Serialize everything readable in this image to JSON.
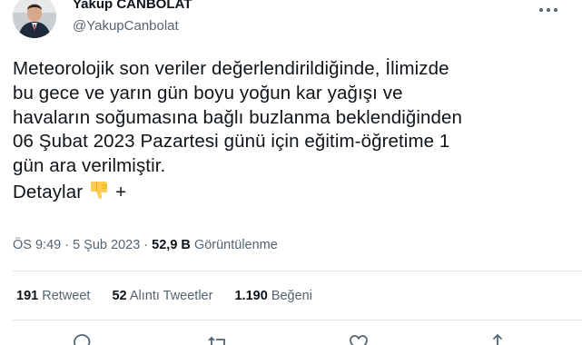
{
  "author": {
    "name": "Yakup CANBOLAT",
    "handle": "@YakupCanbolat"
  },
  "tweet": {
    "lines": [
      "Meteorolojik son veriler değerlendirildiğinde, İlimizde",
      "bu gece ve yarın gün boyu yoğun kar yağışı ve",
      "havaların soğumasına bağlı buzlanma beklendiğinden",
      "06 Şubat 2023 Pazartesi günü için eğitim-öğretime 1",
      "gün ara verilmiştir."
    ],
    "last_line": {
      "text": "Detaylar",
      "suffix": "+",
      "emoji": "thumbs-down-icon"
    }
  },
  "meta": {
    "time": "ÖS 9:49",
    "sep1": " · ",
    "date": "5 Şub 2023",
    "sep2": " · ",
    "views_count": "52,9 B",
    "views_label": "Görüntülenme"
  },
  "stats": {
    "retweets": {
      "count": "191",
      "label": "Retweet"
    },
    "quotes": {
      "count": "52",
      "label": "Alıntı Tweetler"
    },
    "likes": {
      "count": "1.190",
      "label": "Beğeni"
    }
  },
  "actions": [
    "reply-icon",
    "retweet-icon",
    "like-icon",
    "share-icon"
  ],
  "colors": {
    "text": "#0f1419",
    "secondary": "#536471",
    "divider": "#e3e6e8",
    "emoji": "#ffcc4d"
  }
}
